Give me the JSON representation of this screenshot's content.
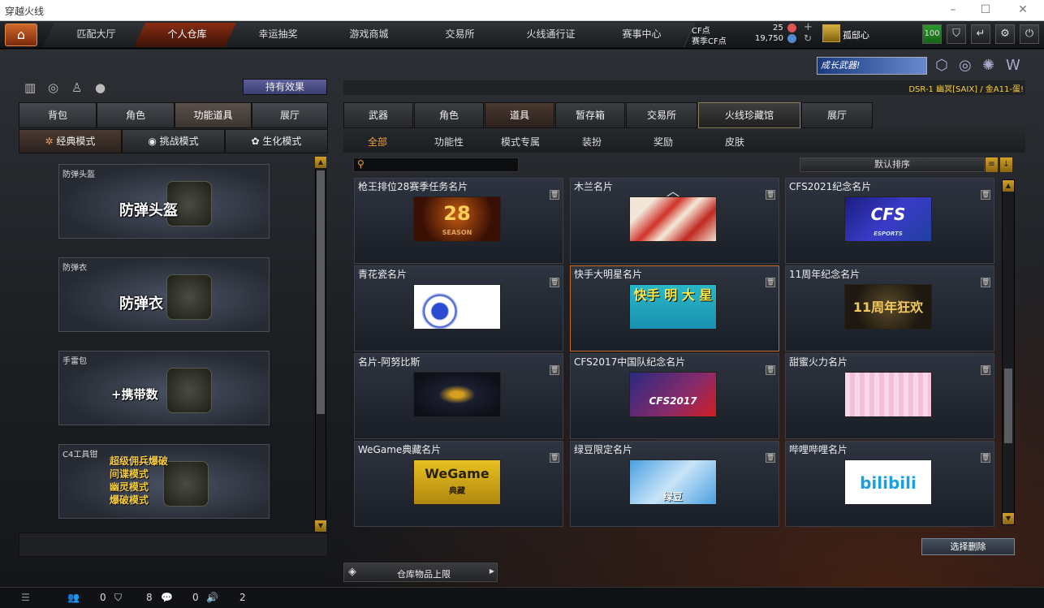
{
  "window": {
    "title": "穿越火线",
    "min_icon": "minimize-icon",
    "max_icon": "maximize-icon",
    "close_icon": "close-icon"
  },
  "nav": {
    "home_icon": "home-icon",
    "tabs": [
      "匹配大厅",
      "个人仓库",
      "幸运抽奖",
      "游戏商城",
      "交易所",
      "火线通行证",
      "赛事中心"
    ],
    "active": "个人仓库"
  },
  "currency": {
    "cf_label": "CF点",
    "cf_value": "25",
    "event_cf_label": "赛季CF点",
    "event_cf_value": "19,750"
  },
  "user": {
    "rank_name": "孤邸心",
    "level": "100"
  },
  "banner": {
    "text": "成长武器!",
    "marquee": "DSR-1 幽冥[SAIX] / 金A11-蛋!"
  },
  "left": {
    "hold_effect": "持有效果",
    "cat_tabs": [
      "背包",
      "角色",
      "功能道具",
      "展厅"
    ],
    "cat_active": "功能道具",
    "mode_tabs": [
      "经典模式",
      "挑战模式",
      "生化模式"
    ],
    "mode_active": "经典模式",
    "items": [
      {
        "tag": "防弹头盔",
        "label": "防弹头盔",
        "icon": "helmet-icon"
      },
      {
        "tag": "防弹衣",
        "label": "防弹衣",
        "icon": "vest-icon"
      },
      {
        "tag": "手雷包",
        "label": "+携带数",
        "icon": "grenade-icon"
      },
      {
        "tag": "C4工具钳",
        "lines": [
          "超级佣兵爆破",
          "间谍模式",
          "幽灵模式",
          "爆破模式"
        ],
        "icon": "c4-tool-icon"
      }
    ]
  },
  "right": {
    "tabs": [
      "武器",
      "角色",
      "道具",
      "暂存箱",
      "交易所",
      "火线珍藏馆",
      "展厅"
    ],
    "tab_active": "道具",
    "subtabs": [
      "全部",
      "功能性",
      "模式专属",
      "装扮",
      "奖励",
      "皮肤"
    ],
    "sub_active": "全部",
    "search_placeholder": "",
    "sort_label": "默认排序",
    "cards": [
      {
        "title": "枪王排位28赛季任务名片",
        "img": "28",
        "img_sub": "SEASON"
      },
      {
        "title": "木兰名片",
        "img": ""
      },
      {
        "title": "CFS2021纪念名片",
        "img": "CFS",
        "img_sub": "ESPORTS"
      },
      {
        "title": "青花瓷名片",
        "img": ""
      },
      {
        "title": "快手大明星名片",
        "img": "快手 明 大 星",
        "selected": true
      },
      {
        "title": "11周年纪念名片",
        "img": "11周年狂欢"
      },
      {
        "title": "名片-阿努比斯",
        "img": ""
      },
      {
        "title": "CFS2017中国队纪念名片",
        "img": "CFS2017"
      },
      {
        "title": "甜蜜火力名片",
        "img": ""
      },
      {
        "title": "WeGame典藏名片",
        "img": "WeGame",
        "img_sub": "典藏"
      },
      {
        "title": "绿豆限定名片",
        "img": "绿豆"
      },
      {
        "title": "哔哩哔哩名片",
        "img": "bilibili"
      }
    ],
    "delete_button": "选择删除",
    "storage_limit": "仓库物品上限"
  },
  "status": {
    "friends": "0",
    "clan": "8",
    "chat": "0",
    "volume": "2"
  }
}
